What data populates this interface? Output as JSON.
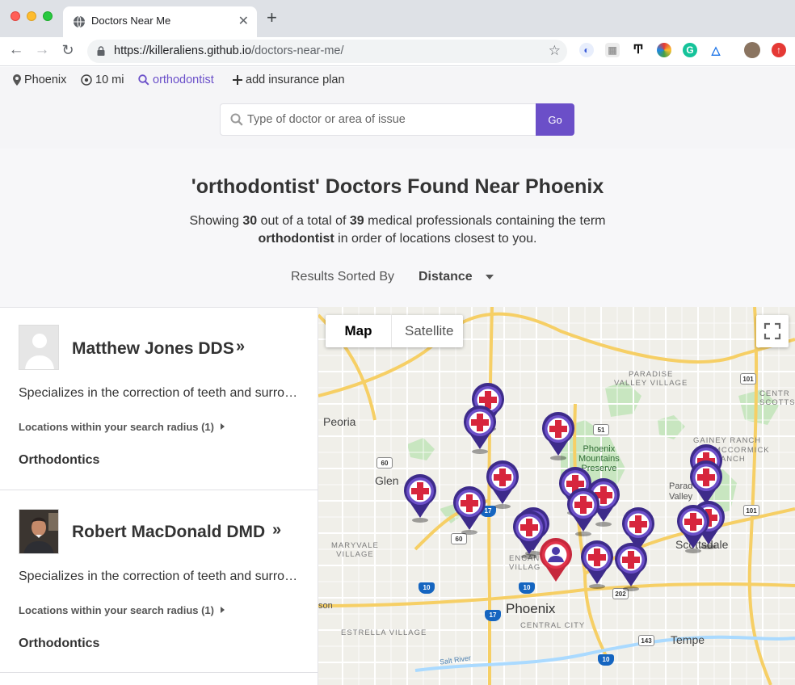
{
  "browser": {
    "tab_title": "Doctors Near Me",
    "url_host": "https://killeraliens.github.io",
    "url_path": "/doctors-near-me/"
  },
  "filters": {
    "location": "Phoenix",
    "radius": "10 mi",
    "term": "orthodontist",
    "insurance": "add insurance plan"
  },
  "search": {
    "placeholder": "Type of doctor or area of issue",
    "button_label": "Go"
  },
  "results": {
    "title": "'orthodontist' Doctors Found Near Phoenix",
    "showing_prefix": "Showing ",
    "shown_count": "30",
    "out_of_text": " out of a total of ",
    "total_count": "39",
    "after_total": " medical professionals containing the term",
    "term": "orthodontist",
    "term_suffix": " in order of locations closest to you.",
    "sort_label": "Results Sorted By",
    "sort_value": "Distance"
  },
  "doctors": [
    {
      "name": "Matthew Jones DDS",
      "description": "Specializes in the correction of teeth and surrounding structures",
      "locations_label": "Locations within your search radius (1)",
      "specialty": "Orthodontics",
      "avatar": "placeholder-silhouette"
    },
    {
      "name": "Robert MacDonald DMD",
      "description": "Specializes in the correction of teeth and surrounding structures",
      "locations_label": "Locations within your search radius (1)",
      "specialty": "Orthodontics",
      "avatar": "photo"
    }
  ],
  "map": {
    "type_map": "Map",
    "type_satellite": "Satellite",
    "labels": {
      "peoria": "Peoria",
      "glendale": "Glen",
      "phoenix": "Phoenix",
      "scottsdale": "Scottsdale",
      "tempe": "Tempe",
      "paradise_valley_village": "PARADISE\nVALLEY VILLAGE",
      "phoenix_mountains": "Phoenix\nMountains\nPreserve",
      "maryvale": "MARYVALE\nVILLAGE",
      "encanto": "ENCANT\nVILLAG",
      "estrella": "ESTRELLA VILLAGE",
      "central_city": "CENTRAL CITY",
      "gainey": "GAINEY RANCH",
      "mccormick": "MCCORMICK\nRANCH",
      "paradise_valley": "Parad\nValley",
      "centr_scotts": "CENTR\nSCOTTS",
      "son": "son",
      "salt_river": "Salt River"
    },
    "highways": [
      "101",
      "51",
      "60",
      "17",
      "60",
      "101",
      "10",
      "10",
      "17",
      "202",
      "143",
      "10",
      "101"
    ],
    "doctor_pin_count": 20,
    "user_pin": "user-location"
  }
}
